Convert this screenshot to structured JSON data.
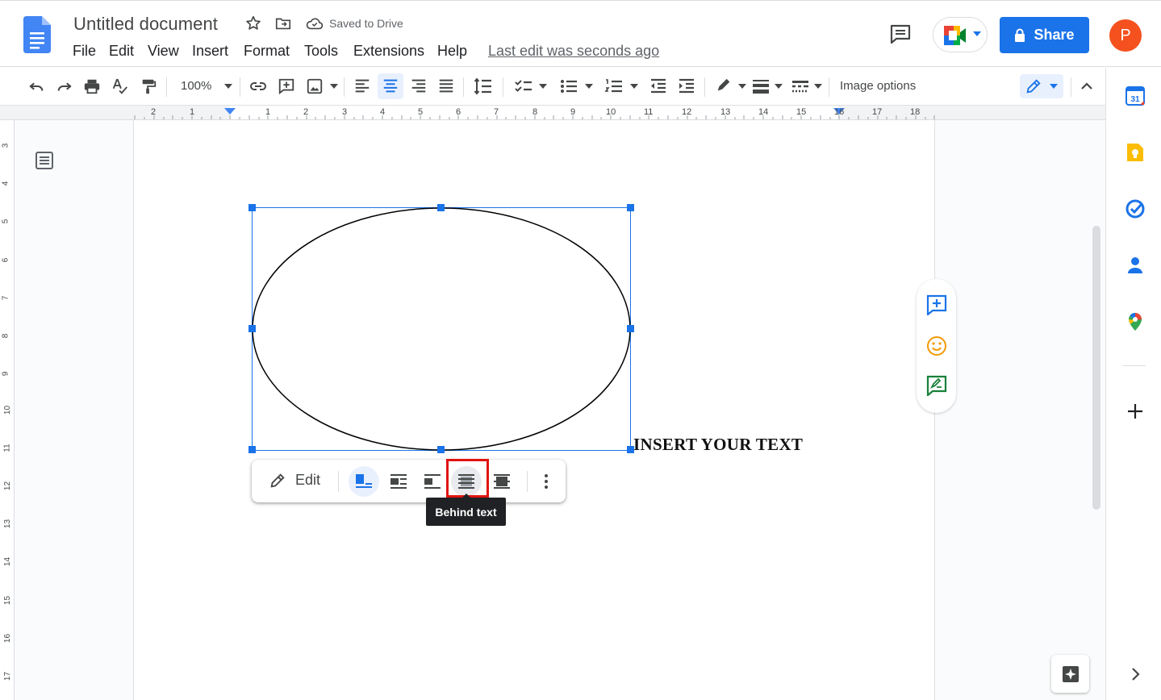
{
  "header": {
    "title": "Untitled document",
    "saved_status": "Saved to Drive",
    "menu": [
      "File",
      "Edit",
      "View",
      "Insert",
      "Format",
      "Tools",
      "Extensions",
      "Help"
    ],
    "last_edit": "Last edit was seconds ago",
    "share_label": "Share",
    "avatar_letter": "P"
  },
  "toolbar": {
    "zoom": "100%",
    "image_options": "Image options",
    "mode": "editing"
  },
  "ruler": {
    "horizontal": [
      "2",
      "1",
      "1",
      "2",
      "3",
      "4",
      "5",
      "6",
      "7",
      "8",
      "9",
      "10",
      "11",
      "12",
      "13",
      "14",
      "15",
      "16",
      "17",
      "18"
    ],
    "vertical": [
      "3",
      "4",
      "5",
      "6",
      "7",
      "8",
      "9",
      "10",
      "11",
      "12",
      "13",
      "14",
      "15",
      "16",
      "17"
    ]
  },
  "document": {
    "body_text": "INSERT YOUR TEXT",
    "shape": "ellipse"
  },
  "image_toolbar": {
    "edit_label": "Edit",
    "wrap_options": [
      "In line",
      "Wrap text",
      "Break text",
      "Behind text",
      "In front of text"
    ],
    "selected_option": "In line",
    "hovered_option": "Behind text",
    "tooltip": "Behind text"
  },
  "side_panel": {
    "apps": [
      "calendar-icon",
      "keep-icon",
      "tasks-icon",
      "contacts-icon",
      "maps-icon"
    ]
  },
  "colors": {
    "accent": "#1a73e8",
    "avatar": "#f4511e",
    "highlight": "#e0140f",
    "tooltip_bg": "#202124"
  }
}
